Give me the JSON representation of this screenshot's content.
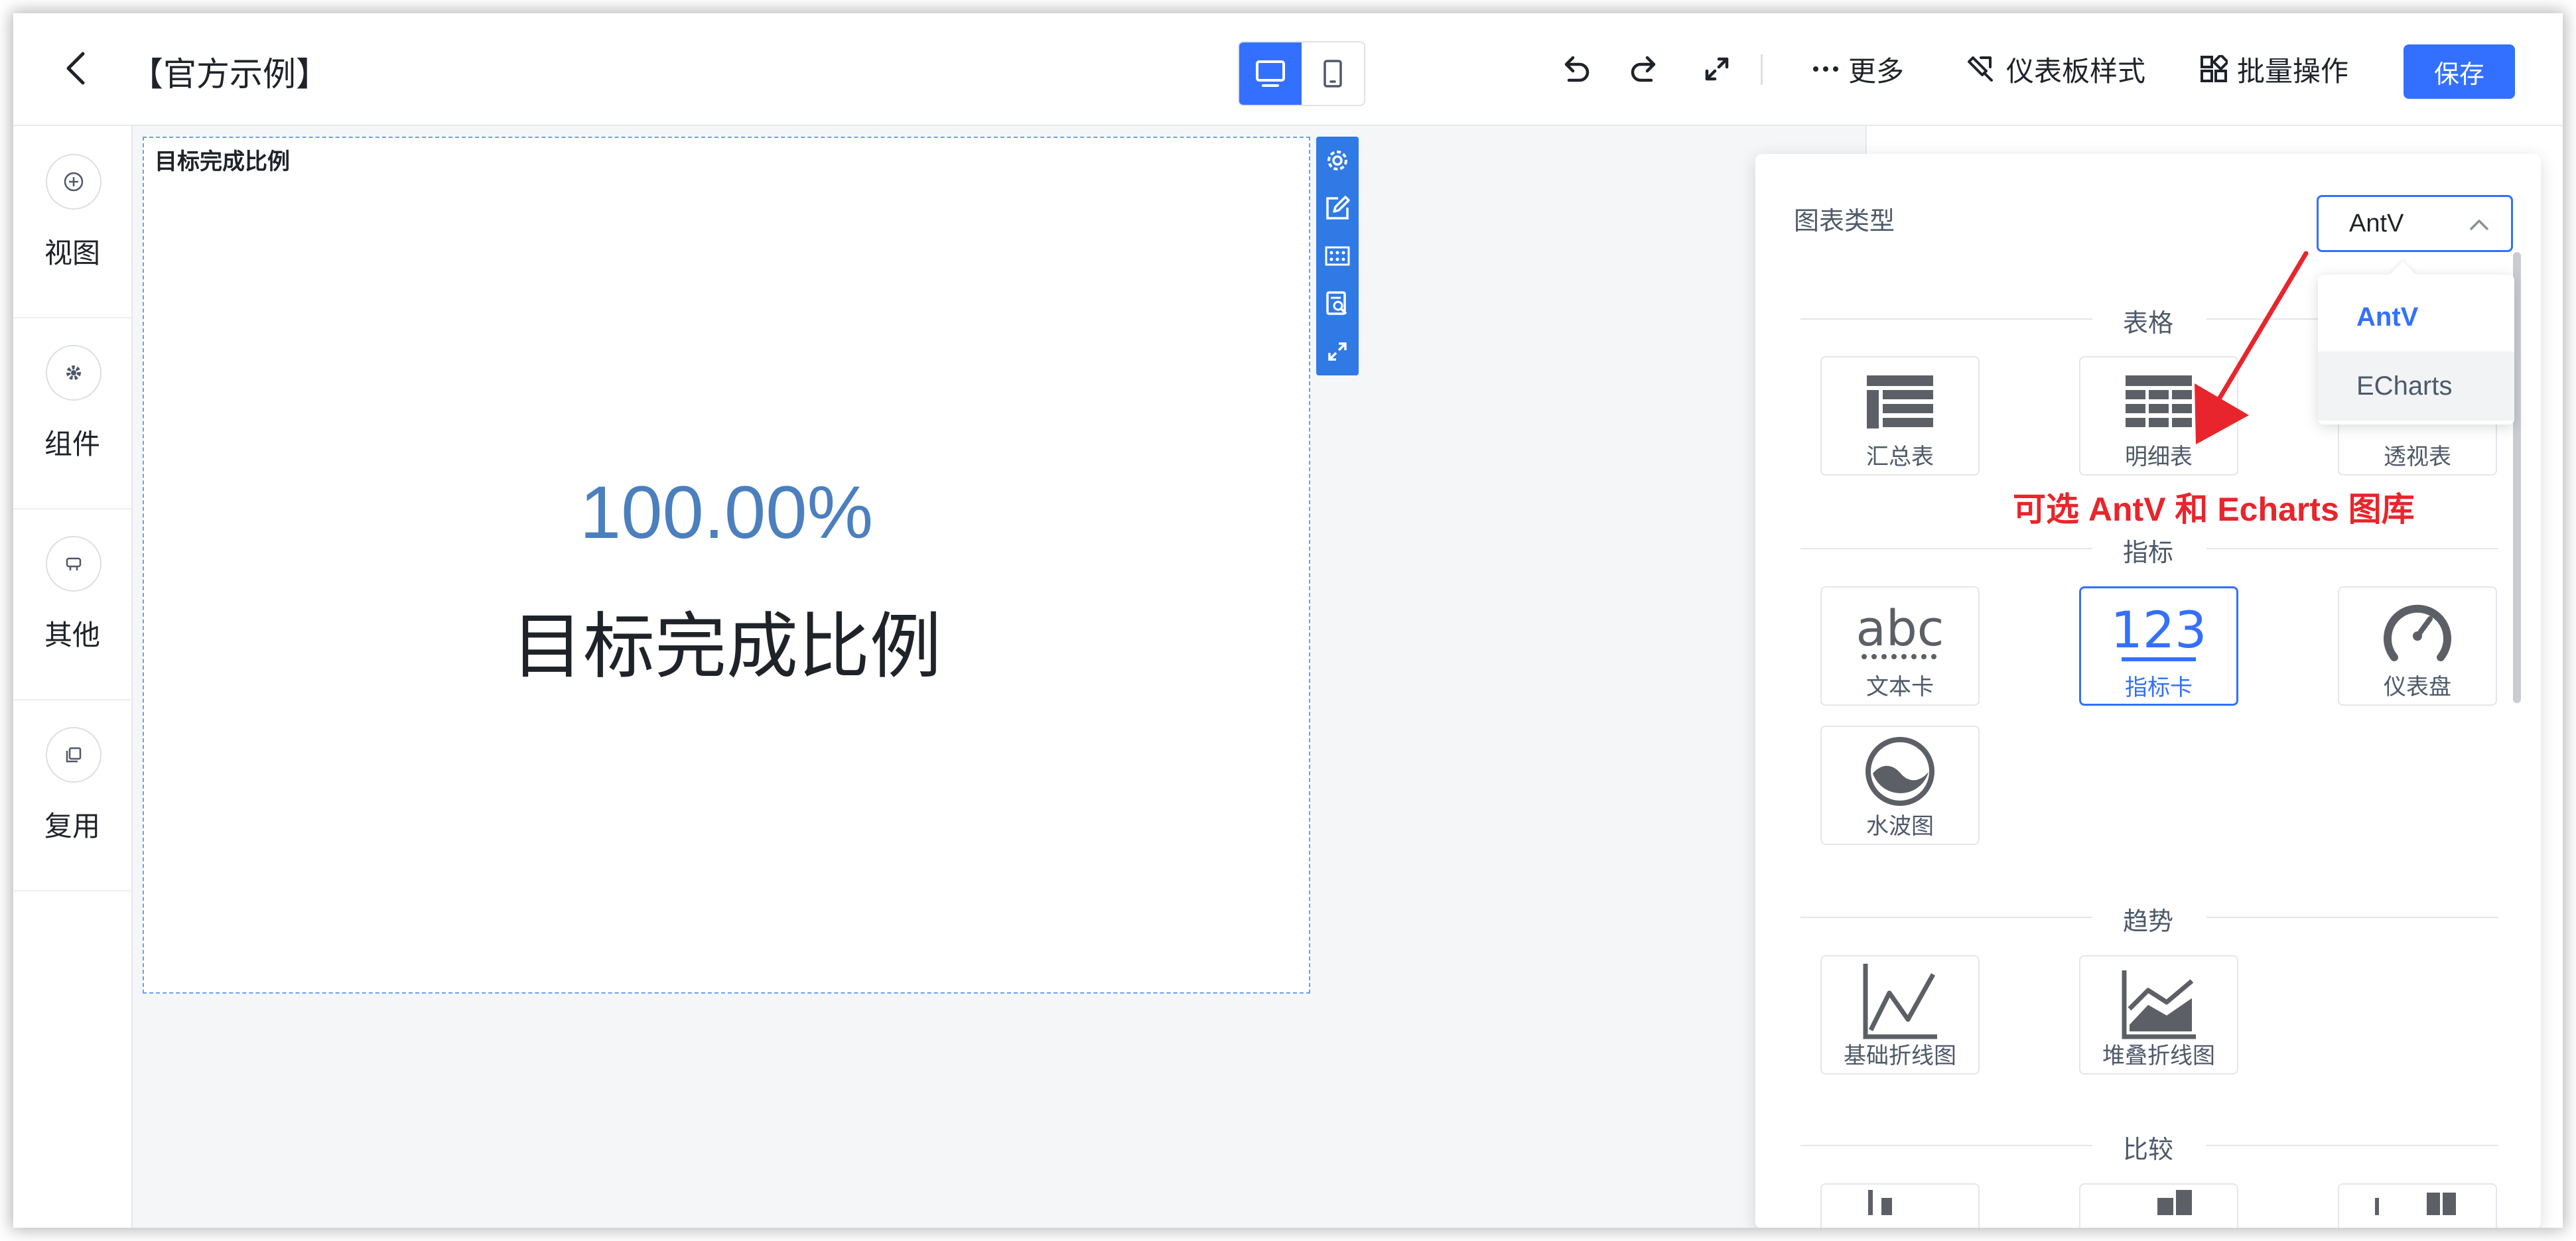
{
  "header": {
    "title": "【官方示例】",
    "more_label": "更多",
    "style_label": "仪表板样式",
    "batch_label": "批量操作",
    "save_label": "保存"
  },
  "left_nav": {
    "items": [
      {
        "label": "视图"
      },
      {
        "label": "组件"
      },
      {
        "label": "其他"
      },
      {
        "label": "复用"
      }
    ]
  },
  "widget": {
    "title": "目标完成比例",
    "value": "100.00%",
    "name": "目标完成比例",
    "value_color": "#4b7fbe"
  },
  "chart_panel": {
    "label": "图表类型",
    "library_selected": "AntV",
    "library_options": [
      "AntV",
      "ECharts"
    ],
    "sections": {
      "table": {
        "title": "表格",
        "items": [
          "汇总表",
          "明细表",
          "透视表"
        ]
      },
      "indicator": {
        "title": "指标",
        "items": [
          "文本卡",
          "指标卡",
          "仪表盘",
          "水波图"
        ],
        "selected": "指标卡",
        "abc_glyph": "abc",
        "num_glyph": "123"
      },
      "trend": {
        "title": "趋势",
        "items": [
          "基础折线图",
          "堆叠折线图"
        ]
      },
      "compare": {
        "title": "比较"
      }
    }
  },
  "annotation": {
    "text": "可选 AntV 和 Echarts 图库",
    "color": "#e8252c"
  },
  "colors": {
    "primary": "#3370ff",
    "widget_toolbar": "#2f7ae5"
  }
}
